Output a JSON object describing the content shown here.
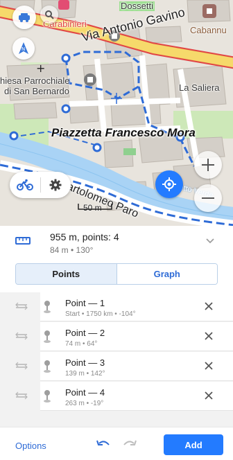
{
  "map": {
    "poi_labels": {
      "carabinieri": "Carabinieri",
      "dossetti": "Dossetti",
      "cabannu": "Cabannu",
      "chiesa_line1": "hiesa Parrochiale",
      "chiesa_line2": "di San Bernardo",
      "la_saliera": "La Saliera",
      "piazzetta": "Piazzetta Francesco Mora",
      "tratto_verde": "Tratto Verde"
    },
    "streets": {
      "via_gavino": "Via Antonio Gavino",
      "via_bartolomeo": "Via Bartolomeo Paro"
    },
    "scale_label": "50 m",
    "route_color": "#2e6bd6",
    "controls": {
      "profile_icon": "bicycle-icon",
      "settings_icon": "gear-icon",
      "zoom_in": "+",
      "zoom_out": "−"
    }
  },
  "summary": {
    "title": "955 m, points: 4",
    "subtitle": "84 m • 130°"
  },
  "tabs": [
    {
      "label": "Points",
      "active": true
    },
    {
      "label": "Graph",
      "active": false
    }
  ],
  "points": [
    {
      "title": "Point — 1",
      "meta": "Start  •  1750 km  •  -104°"
    },
    {
      "title": "Point — 2",
      "meta": "74 m  •  64°"
    },
    {
      "title": "Point — 3",
      "meta": "139 m  •  142°"
    },
    {
      "title": "Point — 4",
      "meta": "263 m  •  -19°"
    }
  ],
  "bottom": {
    "options_label": "Options",
    "add_label": "Add"
  },
  "colors": {
    "accent": "#237bff",
    "link": "#2e6bd6",
    "active_tab_bg": "#e6effa"
  }
}
